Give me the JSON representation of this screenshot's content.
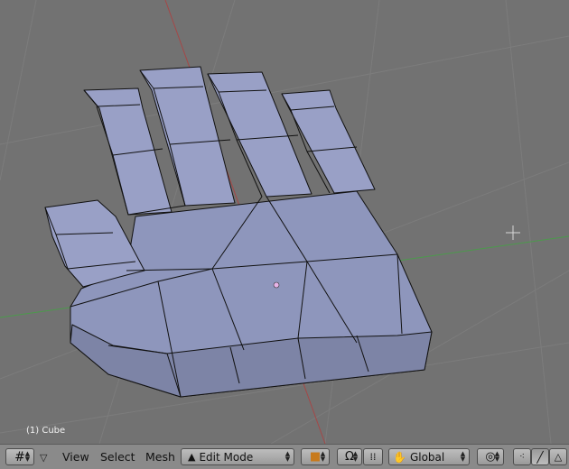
{
  "viewport": {
    "object_info": "(1) Cube",
    "background_color": "#727272",
    "grid_color": "#7c7c7c",
    "axis_x_color": "#4c9a4c",
    "axis_y_color": "#a54747",
    "mesh_color": "#8e96bc",
    "wire_color": "#111111"
  },
  "header": {
    "view_type_icon": "grid-icon",
    "menu_toggle_icon": "triangle-down-icon",
    "menus": [
      "View",
      "Select",
      "Mesh"
    ],
    "mode": {
      "label": "Edit Mode",
      "icon": "edit-mode-icon"
    },
    "shading_icon": "solid-cube-icon",
    "snap_icon": "magnet-icon",
    "manipulator_icon": "hand-icon",
    "orientation": "Global",
    "pivot_icon": "pivot-circle-icon",
    "select_modes": [
      "vertex-select-icon",
      "edge-select-icon",
      "face-select-icon"
    ]
  }
}
